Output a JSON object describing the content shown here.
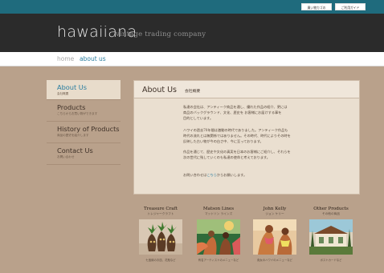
{
  "header": {
    "logo": "hawaiiana",
    "tagline": "vintage trading company",
    "buttons": [
      "買い物カゴの",
      "ご利用ガイド"
    ]
  },
  "breadcrumb": {
    "home": "home",
    "current": "about us"
  },
  "sidebar": {
    "items": [
      {
        "title": "About Us",
        "sub": "会社概要",
        "active": true
      },
      {
        "title": "Products",
        "sub": "こちらからお買い物ができます"
      },
      {
        "title": "History of Products",
        "sub": "商品の歴史を紹介します"
      },
      {
        "title": "Contact Us",
        "sub": "お問い合わせ"
      }
    ]
  },
  "main": {
    "title": "About Us",
    "subtitle": "会社概要",
    "paragraphs": [
      "私達の会社は、アンティーク商品を通し、優れた作品の紹介、更には",
      "商品のバックグラウンド、文化、歴史を お客様にお届けする事を",
      "目的としています。",
      "ハワイの過去70年間は激動の時代でありました。アンティーク作品も",
      "時代の流れとは無関係ではありません。その時代、時代によりその時を",
      "反映した古い物が今の白さ中、今に至っております。",
      "作品を通じて、歴史や文化の真実を日本のお客様にご紹介し、それらを",
      "次の世代に残していくのも私達の使命と考えております。"
    ],
    "contact_prefix": "お問い合わせは",
    "contact_link": "こちら",
    "contact_suffix": "からお願いします。"
  },
  "products": [
    {
      "name": "Treasure Craft",
      "kana": "トレジャークラフト",
      "caption": "七宝焼のお皿、花瓶など"
    },
    {
      "name": "Matson Lines",
      "kana": "マットソン ラインズ",
      "caption": "有名アーティストのメニューなど"
    },
    {
      "name": "John Kelly",
      "kana": "ジョン ケリー",
      "caption": "貴女のハワイのメニューなど"
    },
    {
      "name": "Other Products",
      "kana": "その他の商品",
      "caption": "ポストカードなど"
    }
  ],
  "colors": {
    "topbar": "#1f6b7d",
    "header": "#2b2b2b",
    "page_bg": "#b9a18b",
    "panel": "#eadfd0",
    "link": "#2a7ea0"
  }
}
